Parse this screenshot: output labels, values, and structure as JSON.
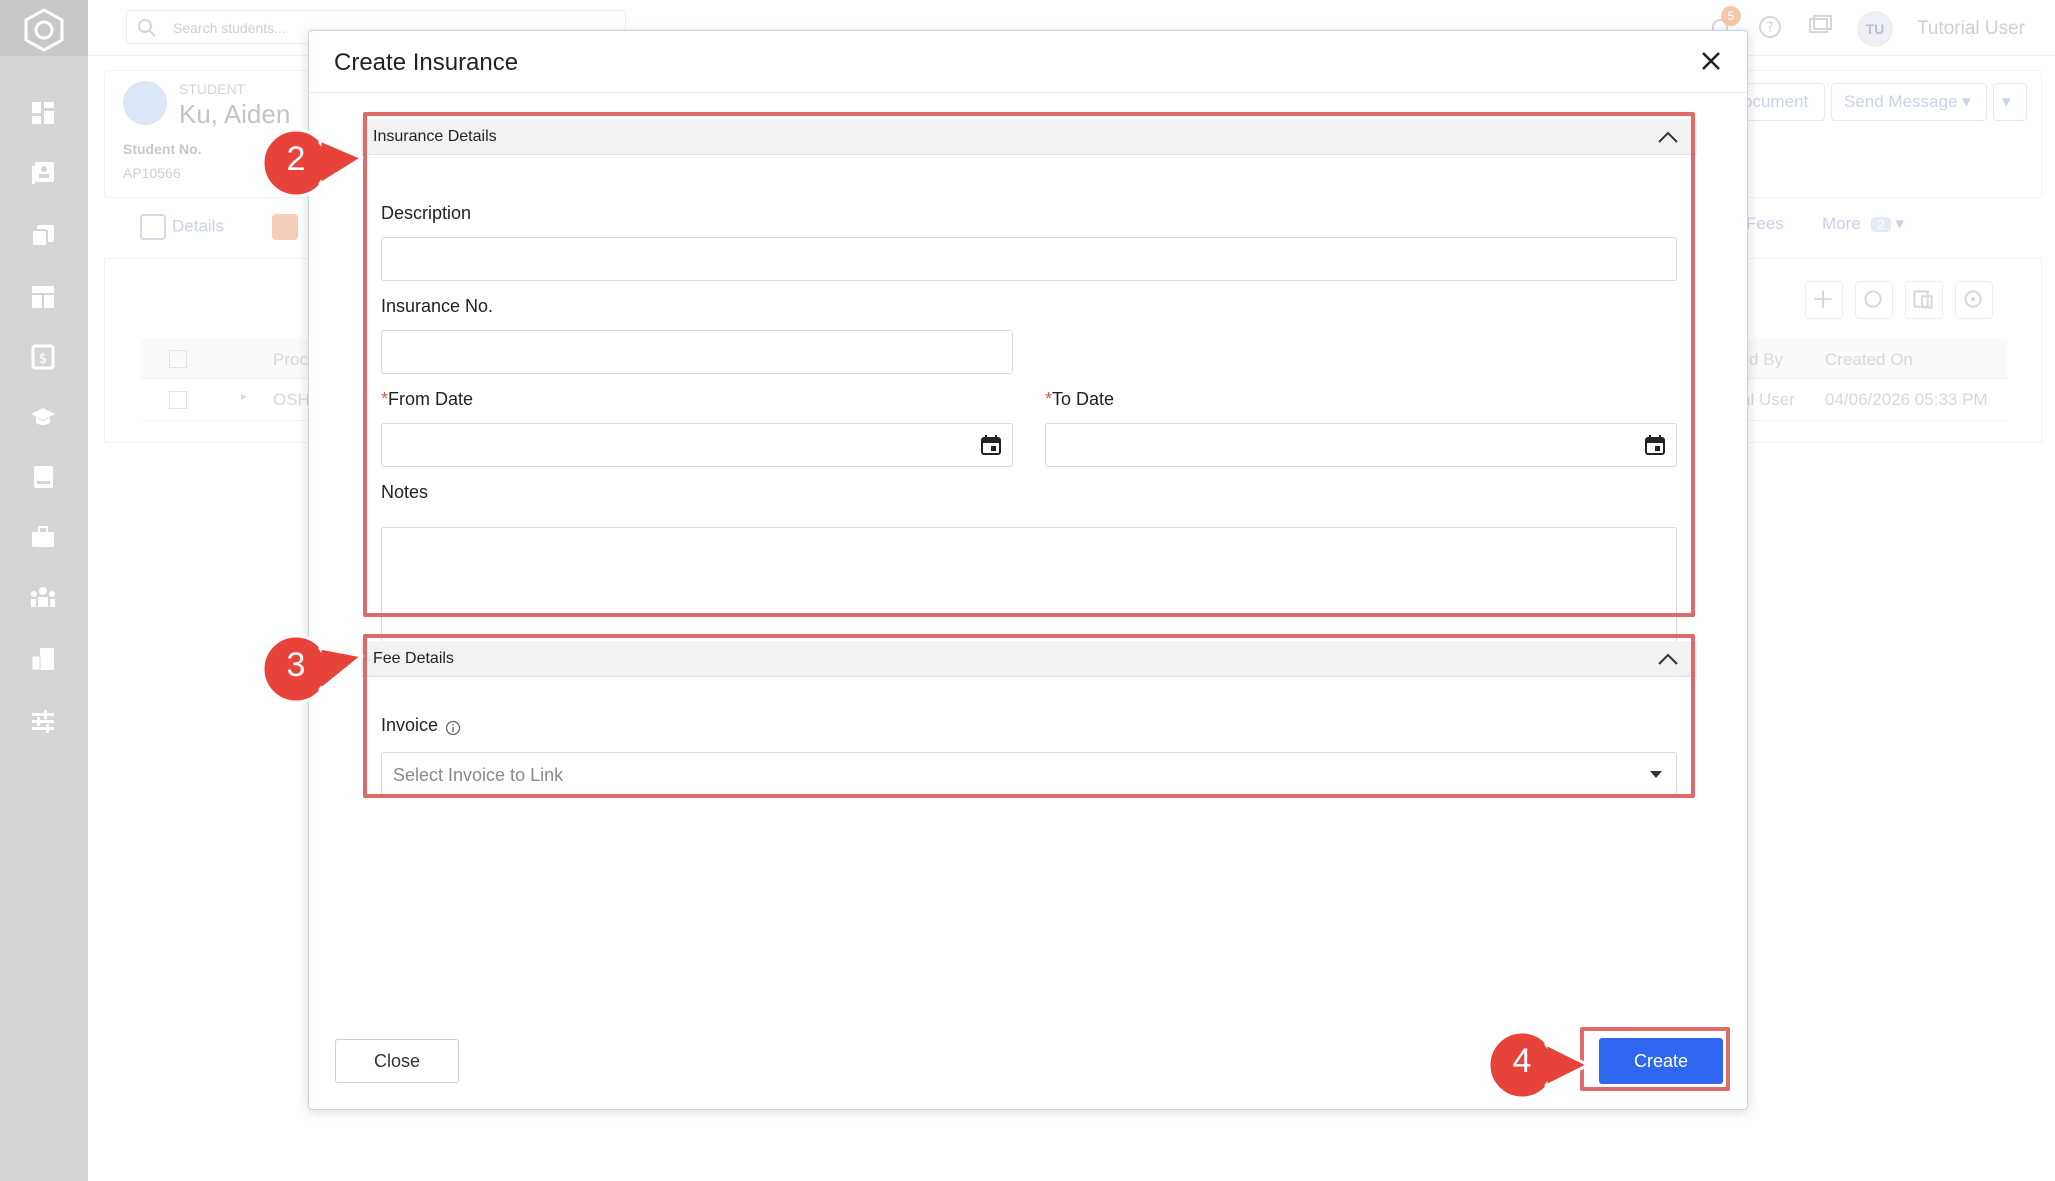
{
  "topbar": {
    "search_placeholder": "Search students...",
    "notification_count": "5",
    "user_initials": "TU",
    "user_name": "Tutorial User"
  },
  "student": {
    "label": "STUDENT",
    "name": "Ku, Aiden",
    "number_label": "Student No.",
    "number_value": "AP10566"
  },
  "header_buttons": {
    "document_label": "ocument",
    "send_message_label": "Send Message"
  },
  "tabs": {
    "details_label": "Details",
    "fees_label": "Fees",
    "more_label": "More",
    "more_count": "2"
  },
  "grid": {
    "col_product": "Proc",
    "col_created_by": "d By",
    "col_created_on": "Created On",
    "row_product": "OSH",
    "row_created_by": "al User",
    "row_created_on": "04/06/2026 05:33 PM"
  },
  "modal": {
    "title": "Create Insurance",
    "insurance_section": {
      "title": "Insurance Details",
      "description_label": "Description",
      "insurance_no_label": "Insurance No.",
      "from_date_label": "From Date",
      "to_date_label": "To Date",
      "required_mark": "*",
      "notes_label": "Notes"
    },
    "fee_section": {
      "title": "Fee Details",
      "invoice_label": "Invoice",
      "invoice_placeholder": "Select Invoice to Link"
    },
    "close_label": "Close",
    "create_label": "Create"
  },
  "callouts": {
    "step2": "2",
    "step3": "3",
    "step4": "4"
  },
  "colors": {
    "primary_button": "#2f67f0",
    "highlight_border": "#e06a6a",
    "callout_fill": "#e8433a",
    "sidebar_bg": "#d5d5d5"
  }
}
